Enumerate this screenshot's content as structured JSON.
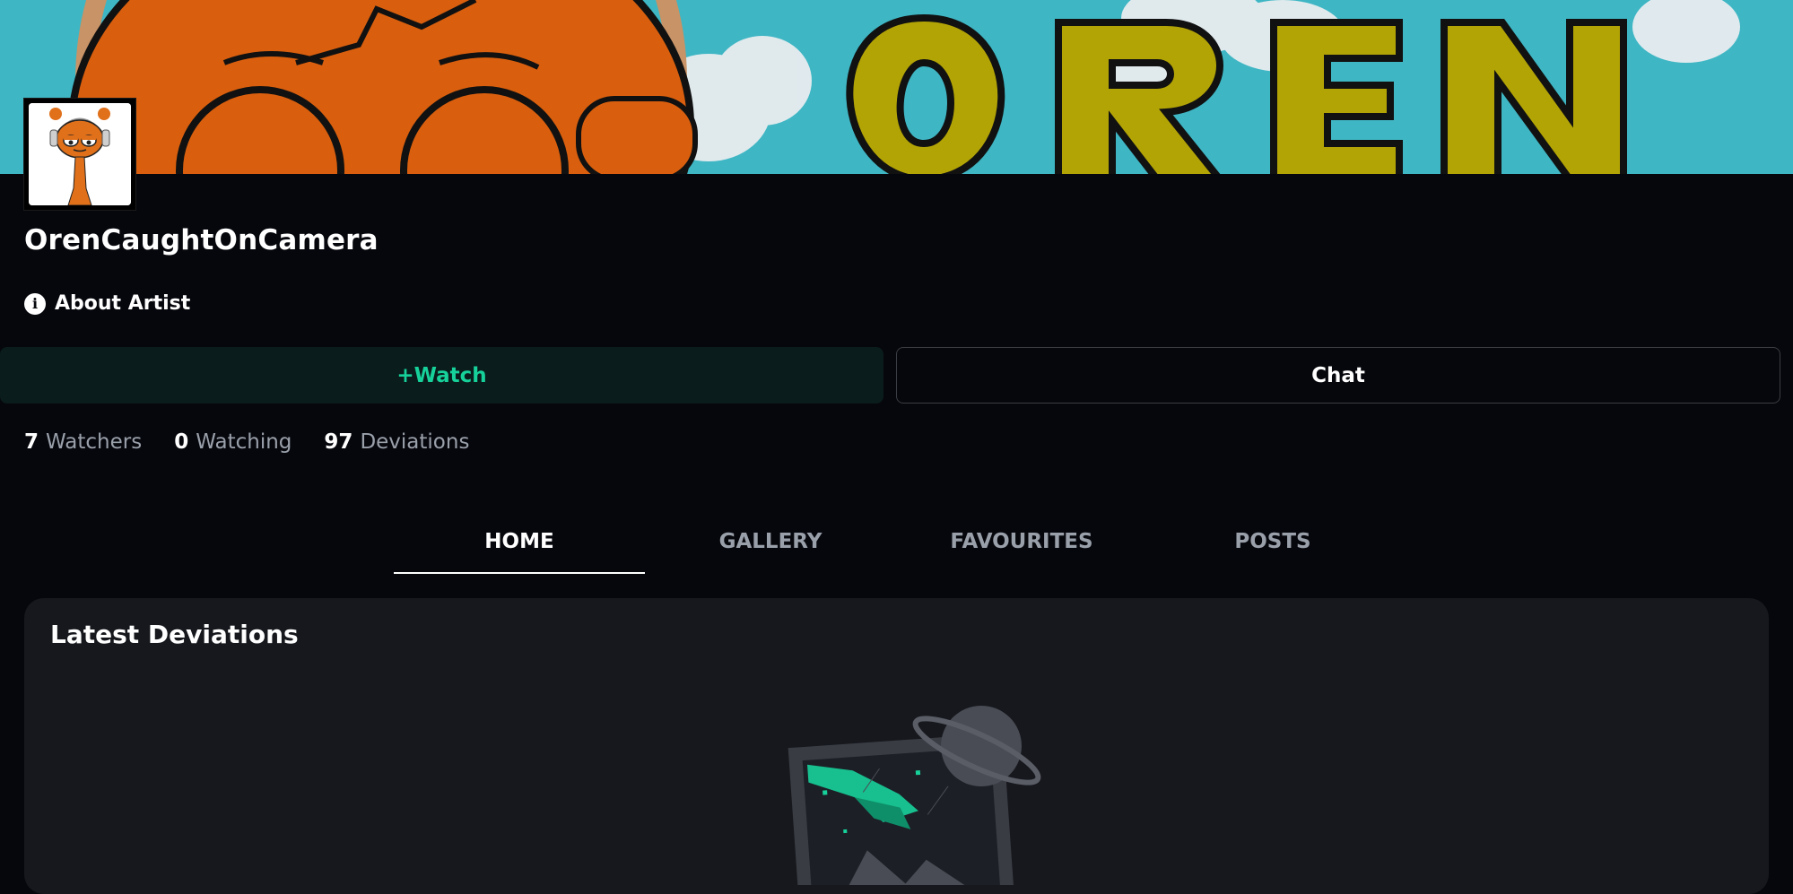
{
  "profile": {
    "username": "OrenCaughtOnCamera",
    "about_label": "About Artist"
  },
  "actions": {
    "watch_label": "+Watch",
    "chat_label": "Chat"
  },
  "stats": [
    {
      "value": "7",
      "label": "Watchers"
    },
    {
      "value": "0",
      "label": "Watching"
    },
    {
      "value": "97",
      "label": "Deviations"
    }
  ],
  "tabs": [
    {
      "label": "HOME",
      "active": true
    },
    {
      "label": "GALLERY",
      "active": false
    },
    {
      "label": "FAVOURITES",
      "active": false
    },
    {
      "label": "POSTS",
      "active": false
    }
  ],
  "latest": {
    "title": "Latest Deviations"
  },
  "banner": {
    "text": "OREN"
  },
  "colors": {
    "watch_accent": "#17d19a",
    "background": "#06070d",
    "card": "#16181d",
    "banner_sky": "#3fb6c4",
    "banner_text": "#b3a406",
    "character_orange": "#d95f0e"
  },
  "icons": {
    "about": "info-icon",
    "empty_state": "planet-frame-illustration"
  }
}
